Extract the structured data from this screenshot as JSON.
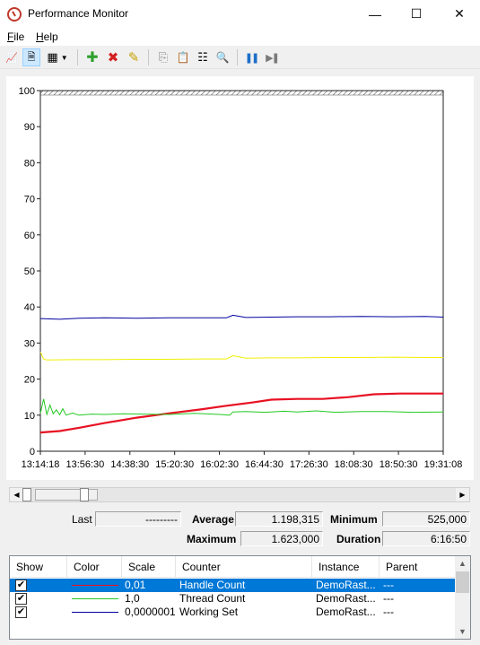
{
  "window": {
    "title": "Performance Monitor",
    "minimize_glyph": "—",
    "maximize_glyph": "☐",
    "close_glyph": "✕"
  },
  "menu": {
    "file": "File",
    "file_key": "F",
    "file_rest": "ile",
    "help": "Help",
    "help_key": "H",
    "help_rest": "elp"
  },
  "toolbar": {
    "buttons": [
      {
        "name": "view-current-activity-icon",
        "glyph": "📈"
      },
      {
        "name": "view-log-data-icon",
        "glyph": "🗎",
        "active": true
      },
      {
        "name": "change-graph-type-icon",
        "glyph": "▦"
      },
      {
        "name": "add-counter-icon",
        "glyph": "✚",
        "color": "#2ea02e"
      },
      {
        "name": "delete-counter-icon",
        "glyph": "✖",
        "color": "#d42020"
      },
      {
        "name": "highlight-icon",
        "glyph": "✎",
        "color": "#c8a000"
      },
      {
        "name": "copy-properties-icon",
        "glyph": "⎘"
      },
      {
        "name": "paste-counter-list-icon",
        "glyph": "📋"
      },
      {
        "name": "properties-icon",
        "glyph": "☷"
      },
      {
        "name": "zoom-icon",
        "glyph": "🔍"
      },
      {
        "name": "freeze-display-icon",
        "glyph": "❚❚",
        "color": "#1e6fc8"
      },
      {
        "name": "update-data-icon",
        "glyph": "▶❚",
        "color": "#7a7a7a"
      }
    ]
  },
  "chart_data": {
    "type": "line",
    "title": "",
    "xlabel": "",
    "ylabel": "",
    "ylim": [
      0,
      100
    ],
    "y_ticks": [
      "0",
      "10",
      "20",
      "30",
      "40",
      "50",
      "60",
      "70",
      "80",
      "90",
      "100"
    ],
    "x_ticks": [
      "13:14:18",
      "13:56:30",
      "14:38:30",
      "15:20:30",
      "16:02:30",
      "16:44:30",
      "17:26:30",
      "18:08:30",
      "18:50:30",
      "19:31:08"
    ],
    "x_range_hours": [
      0,
      6.2778
    ],
    "grid": false,
    "series": [
      {
        "counter": "Handle Count",
        "color": "#e81123",
        "x": [
          0,
          0.3,
          0.6,
          1.0,
          1.5,
          2.0,
          2.5,
          2.9,
          3.3,
          3.6,
          4.0,
          4.4,
          4.8,
          5.2,
          5.6,
          6.0,
          6.28
        ],
        "values": [
          5.2,
          5.6,
          6.5,
          7.8,
          9.3,
          10.5,
          11.6,
          12.6,
          13.5,
          14.3,
          14.5,
          14.5,
          15.0,
          15.8,
          16.0,
          16.0,
          16.0
        ]
      },
      {
        "counter": "Thread Count",
        "color": "#22c922",
        "x": [
          0,
          0.05,
          0.1,
          0.15,
          0.2,
          0.25,
          0.3,
          0.35,
          0.4,
          0.5,
          0.6,
          0.8,
          1.0,
          1.3,
          1.6,
          2.0,
          2.4,
          2.8,
          2.95,
          3.0,
          3.2,
          3.5,
          3.8,
          4.0,
          4.3,
          4.6,
          5.0,
          5.4,
          5.8,
          6.28
        ],
        "values": [
          10.5,
          14.5,
          10.2,
          12.8,
          10.4,
          11.5,
          10.1,
          11.8,
          10.0,
          10.6,
          10.0,
          10.3,
          10.2,
          10.4,
          10.3,
          10.2,
          10.5,
          10.2,
          10.0,
          10.9,
          11.0,
          10.8,
          11.1,
          10.9,
          11.2,
          10.8,
          11.0,
          11.0,
          10.8,
          10.9
        ]
      },
      {
        "counter": "Working Set",
        "color": "#0000a0",
        "x": [
          0,
          0.3,
          0.6,
          1.0,
          1.5,
          2.0,
          2.5,
          2.9,
          3.0,
          3.2,
          3.6,
          4.0,
          4.5,
          5.0,
          5.5,
          6.0,
          6.28
        ],
        "values": [
          36.8,
          36.6,
          36.9,
          37.0,
          36.9,
          37.0,
          37.0,
          37.0,
          37.7,
          37.1,
          37.2,
          37.3,
          37.3,
          37.4,
          37.3,
          37.4,
          37.2
        ]
      },
      {
        "counter": "",
        "color": "#f0f000",
        "x": [
          0,
          0.05,
          0.1,
          0.5,
          1.0,
          1.5,
          2.0,
          2.5,
          2.9,
          3.0,
          3.2,
          3.6,
          4.0,
          4.5,
          5.0,
          5.5,
          6.0,
          6.28
        ],
        "values": [
          27.5,
          25.6,
          25.3,
          25.4,
          25.4,
          25.5,
          25.5,
          25.6,
          25.6,
          26.5,
          25.8,
          25.9,
          25.9,
          26.0,
          26.0,
          26.1,
          26.0,
          26.0
        ]
      }
    ]
  },
  "stats": {
    "last_label": "Last",
    "last_value": "---------",
    "average_label": "Average",
    "average_value": "1.198,315",
    "minimum_label": "Minimum",
    "minimum_value": "525,000",
    "maximum_label": "Maximum",
    "maximum_value": "1.623,000",
    "duration_label": "Duration",
    "duration_value": "6:16:50"
  },
  "counter_list": {
    "columns": [
      "Show",
      "Color",
      "Scale",
      "Counter",
      "Instance",
      "Parent"
    ],
    "rows": [
      {
        "show": "✔",
        "color": "#e81123",
        "scale": "0,01",
        "counter": "Handle Count",
        "instance": "DemoRast...",
        "parent": "---",
        "selected": true
      },
      {
        "show": "✔",
        "color": "#22c922",
        "scale": "1,0",
        "counter": "Thread Count",
        "instance": "DemoRast...",
        "parent": "---",
        "selected": false
      },
      {
        "show": "✔",
        "color": "#0000a0",
        "scale": "0,0000001",
        "counter": "Working Set",
        "instance": "DemoRast...",
        "parent": "---",
        "selected": false
      }
    ]
  }
}
